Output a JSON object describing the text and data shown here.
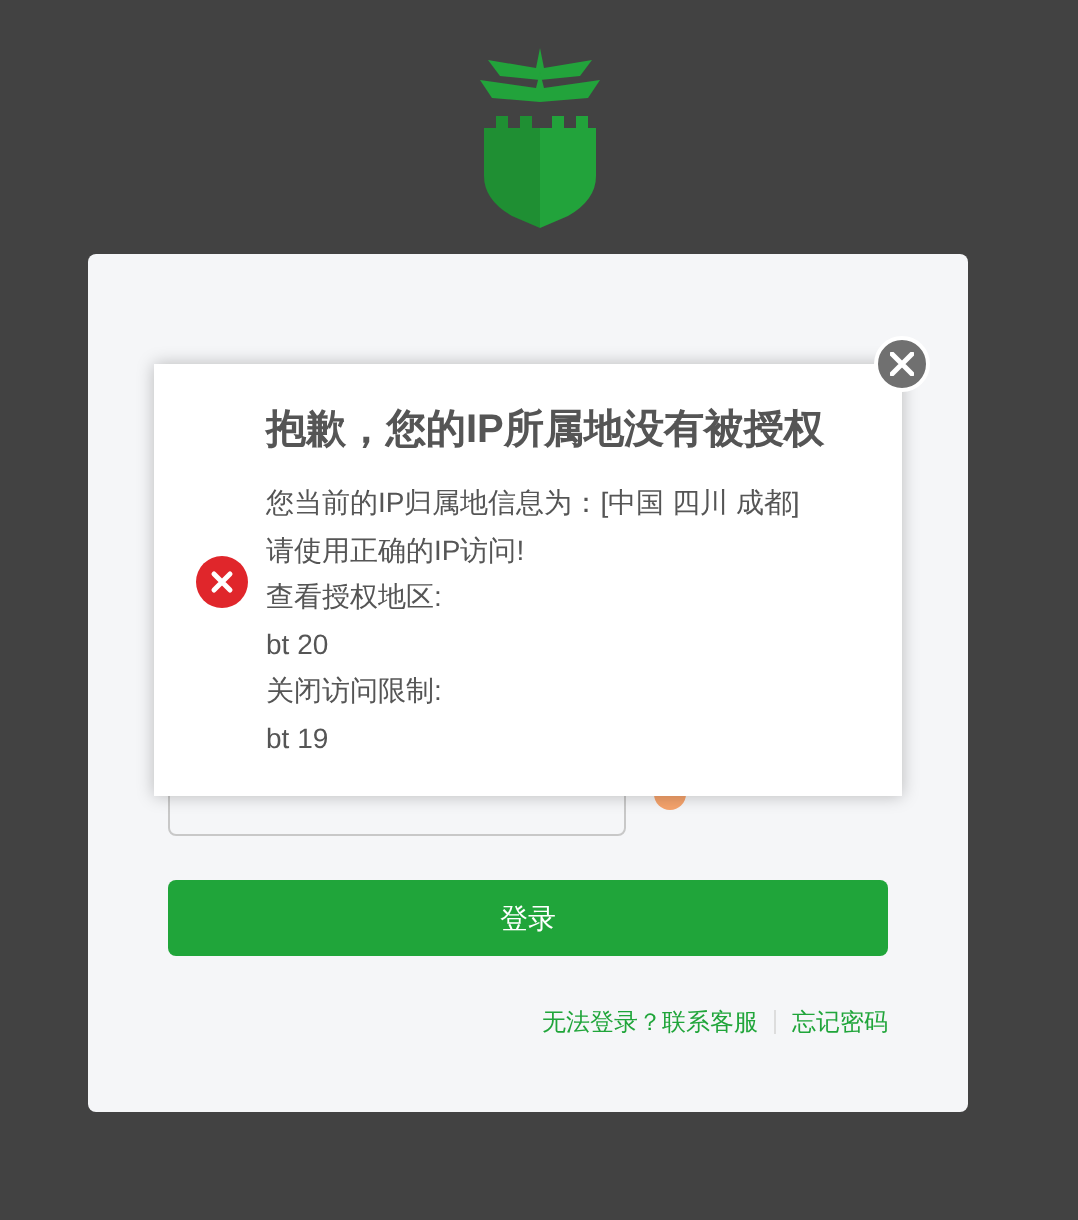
{
  "login": {
    "submit_button": "登录",
    "links": [
      "无法登录？联系客服",
      "忘记密码"
    ]
  },
  "dialog": {
    "title": "抱歉，您的IP所属地没有被授权",
    "lines": [
      "您当前的IP归属地信息为：[中国 四川 成都]",
      "请使用正确的IP访问!",
      "查看授权地区:",
      "bt 20",
      "关闭访问限制:",
      "bt 19"
    ]
  }
}
